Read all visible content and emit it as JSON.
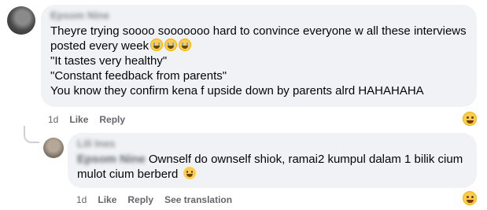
{
  "comment": {
    "author": "Epsom Nine",
    "lines": [
      "Theyre trying soooo sooooooo hard to convince everyone w all these interviews",
      "posted every week",
      "\"It tastes very healthy\"",
      "\"Constant feedback from parents\"",
      "You know they confirm kena f upside down by parents alrd HAHAHAHA"
    ],
    "emojis": [
      "crying-face-emoji",
      "crying-face-emoji",
      "crying-face-emoji"
    ],
    "time": "1d",
    "like_label": "Like",
    "reply_label": "Reply",
    "reaction_icon": "laughing-face-icon"
  },
  "reply": {
    "author": "Lili Ines",
    "mention": "Epsom Nine",
    "text_line1": "Ownself do ownself shiok, ramai2 kumpul dalam 1 bilik cium",
    "text_line2": "mulot cium berberd",
    "emoji": "rolling-laughing-emoji",
    "time": "1d",
    "like_label": "Like",
    "reply_label": "Reply",
    "see_translation_label": "See translation",
    "reaction_icon": "laughing-face-icon"
  }
}
